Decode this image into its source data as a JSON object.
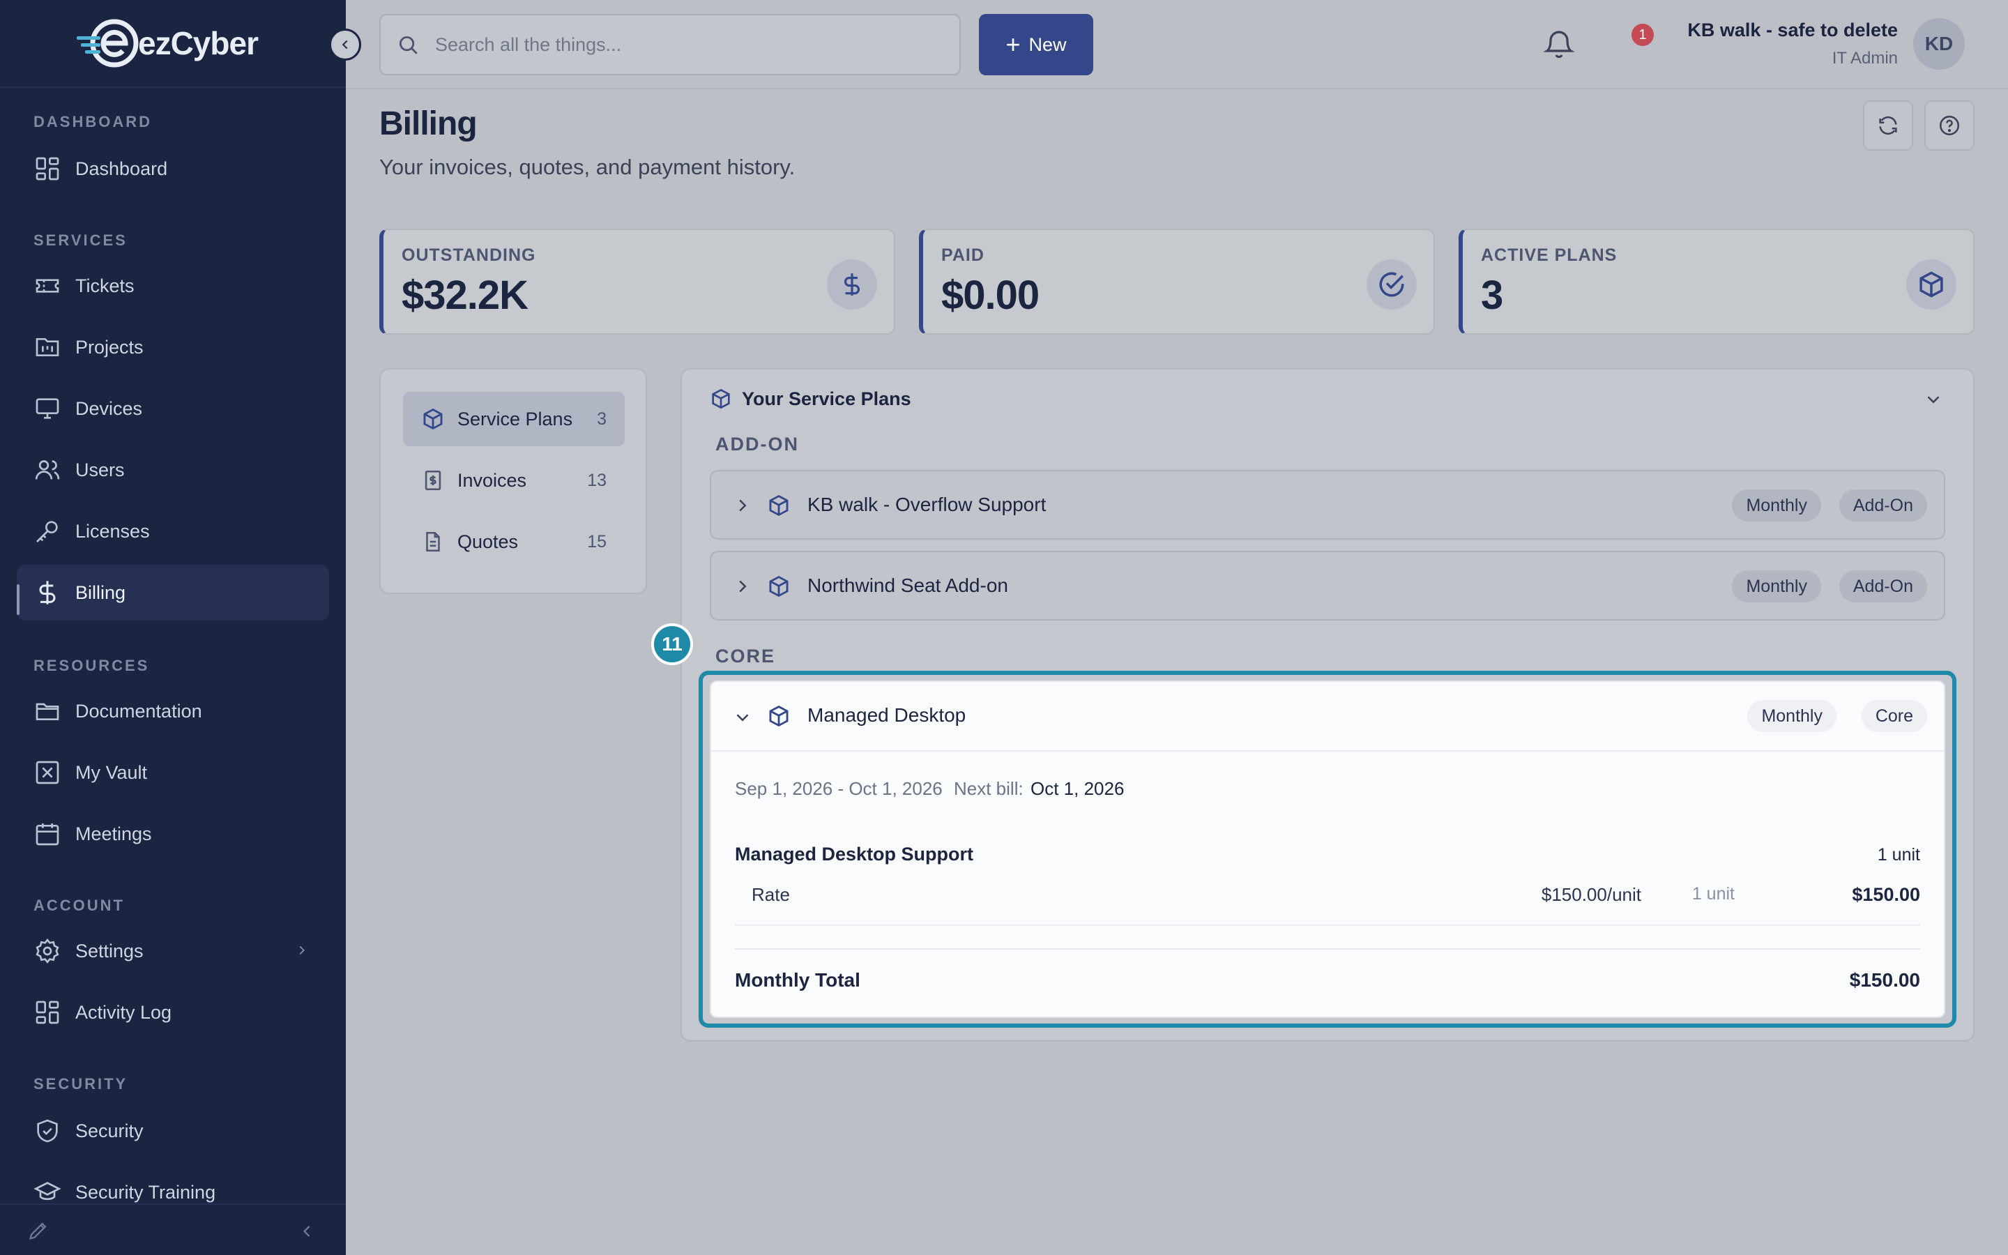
{
  "app": {
    "logo_text": "ezCyber"
  },
  "sidebar": {
    "sections": {
      "dashboard": "DASHBOARD",
      "services": "SERVICES",
      "resources": "RESOURCES",
      "account": "ACCOUNT",
      "security": "SECURITY"
    },
    "items": {
      "dashboard": "Dashboard",
      "tickets": "Tickets",
      "projects": "Projects",
      "devices": "Devices",
      "users": "Users",
      "licenses": "Licenses",
      "billing": "Billing",
      "documentation": "Documentation",
      "vault": "My Vault",
      "meetings": "Meetings",
      "settings": "Settings",
      "activity_log": "Activity Log",
      "security": "Security",
      "security_training": "Security Training"
    },
    "active_item": "Billing"
  },
  "topbar": {
    "search_placeholder": "Search all the things...",
    "new_button": "New",
    "notification_count": "1",
    "user_name": "KB walk - safe to delete",
    "user_role": "IT Admin",
    "avatar_initials": "KD"
  },
  "page": {
    "title": "Billing",
    "subtitle": "Your invoices, quotes, and payment history."
  },
  "stats": [
    {
      "label": "OUTSTANDING",
      "value": "$32.2K",
      "icon": "dollar-icon"
    },
    {
      "label": "PAID",
      "value": "$0.00",
      "icon": "check-circle-icon"
    },
    {
      "label": "ACTIVE PLANS",
      "value": "3",
      "icon": "box-icon"
    }
  ],
  "subnav": [
    {
      "label": "Service Plans",
      "count": "3",
      "active": true
    },
    {
      "label": "Invoices",
      "count": "13"
    },
    {
      "label": "Quotes",
      "count": "15"
    }
  ],
  "plans": {
    "header": "Your Service Plans",
    "addon_label": "ADD-ON",
    "core_label": "CORE",
    "addons": [
      {
        "name": "KB walk - Overflow Support",
        "tags": [
          "Monthly",
          "Add-On"
        ]
      },
      {
        "name": "Northwind Seat Add-on",
        "tags": [
          "Monthly",
          "Add-On"
        ]
      }
    ],
    "core": {
      "name": "Managed Desktop",
      "tags": [
        "Monthly",
        "Core"
      ],
      "period": "Sep 1, 2026 - Oct 1, 2026",
      "next_bill_label": "Next bill:",
      "next_bill_date": "Oct 1, 2026",
      "line_item": {
        "name": "Managed Desktop Support",
        "units": "1 unit",
        "rate_label": "Rate",
        "rate_price": "$150.00/unit",
        "rate_units": "1 unit",
        "rate_total": "$150.00"
      },
      "total_label": "Monthly Total",
      "total_value": "$150.00"
    }
  },
  "step_badge": "11",
  "colors": {
    "sidebar_bg": "#1b2440",
    "accent": "#33478a",
    "highlight": "#1f8aa8",
    "badge": "#c44b55"
  }
}
